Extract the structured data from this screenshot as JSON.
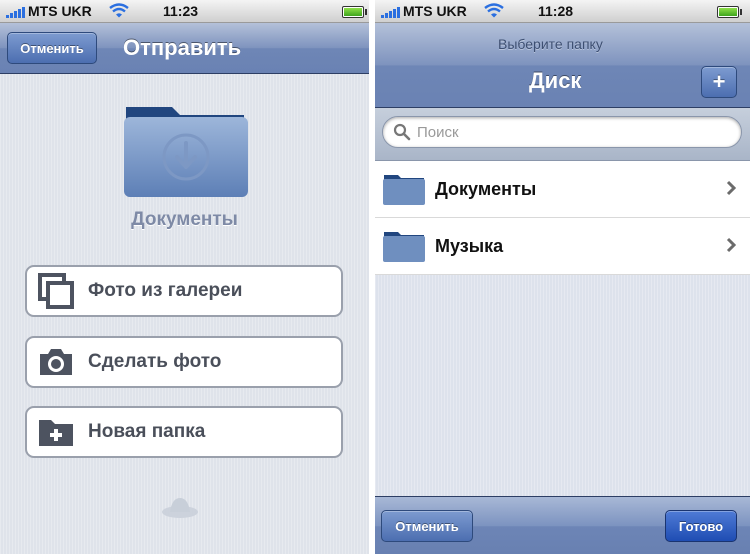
{
  "left": {
    "status": {
      "carrier": "MTS UKR",
      "time": "11:23"
    },
    "nav": {
      "cancel_label": "Отменить",
      "title": "Отправить"
    },
    "folder_name": "Документы",
    "actions": [
      {
        "label": "Фото из галереи",
        "icon": "gallery-icon"
      },
      {
        "label": "Сделать фото",
        "icon": "camera-icon"
      },
      {
        "label": "Новая папка",
        "icon": "new-folder-icon"
      }
    ]
  },
  "right": {
    "status": {
      "carrier": "MTS UKR",
      "time": "11:28"
    },
    "nav": {
      "prompt": "Выберите папку",
      "title": "Диск",
      "add_label": "+"
    },
    "search": {
      "placeholder": "Поиск",
      "value": ""
    },
    "folders": [
      {
        "label": "Документы",
        "icon": "folder-icon"
      },
      {
        "label": "Музыка",
        "icon": "folder-icon"
      }
    ],
    "toolbar": {
      "cancel_label": "Отменить",
      "done_label": "Готово"
    }
  },
  "colors": {
    "nav_blue": "#7e93be",
    "button_blue": "#4c6eb0",
    "done_blue": "#1f4db3",
    "background": "#dfe3ea",
    "label_gray": "#4a4f5a",
    "folder_blue": "#6f8fbf"
  }
}
